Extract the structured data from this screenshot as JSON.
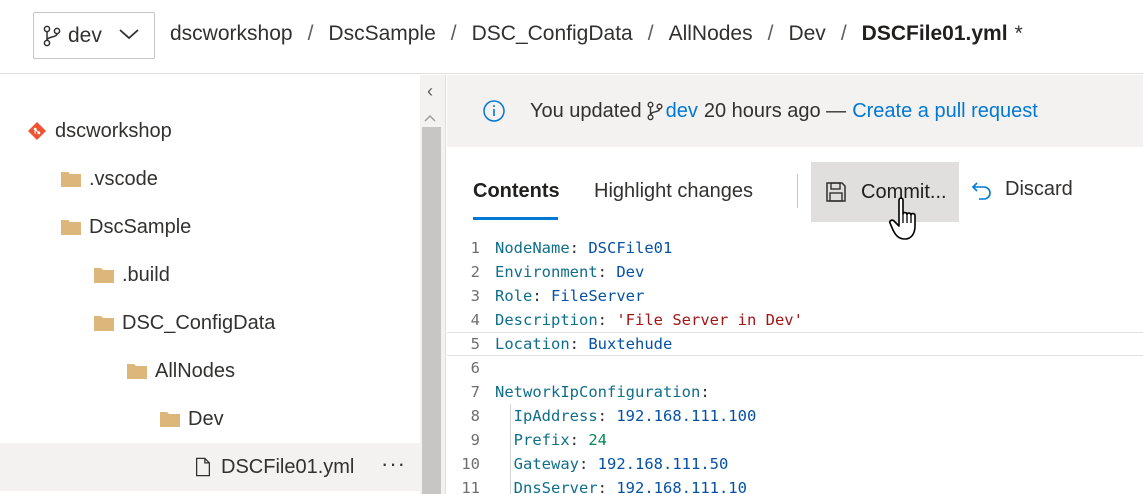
{
  "header": {
    "branch": "dev",
    "breadcrumb": [
      "dscworkshop",
      "DscSample",
      "DSC_ConfigData",
      "AllNodes",
      "Dev"
    ],
    "separator": "/",
    "current_file": "DSCFile01.yml",
    "dirty_marker": "*"
  },
  "tree": {
    "items": [
      {
        "label": "dscworkshop",
        "type": "repo"
      },
      {
        "label": ".vscode",
        "type": "folder"
      },
      {
        "label": "DscSample",
        "type": "folder"
      },
      {
        "label": ".build",
        "type": "folder"
      },
      {
        "label": "DSC_ConfigData",
        "type": "folder"
      },
      {
        "label": "AllNodes",
        "type": "folder"
      },
      {
        "label": "Dev",
        "type": "folder"
      },
      {
        "label": "DSCFile01.yml",
        "type": "file",
        "selected": true
      }
    ],
    "more_label": "···",
    "collapse_glyph": "‹"
  },
  "banner": {
    "prefix": "You updated",
    "branch": "dev",
    "suffix": "20 hours ago —",
    "link": "Create a pull request"
  },
  "toolbar": {
    "tabs": [
      "Contents",
      "Highlight changes"
    ],
    "active_tab": "Contents",
    "commit_label": "Commit...",
    "discard_label": "Discard"
  },
  "editor": {
    "lines": [
      {
        "n": "1",
        "key": "NodeName",
        "val": "DSCFile01",
        "kind": "val"
      },
      {
        "n": "2",
        "key": "Environment",
        "val": "Dev",
        "kind": "val"
      },
      {
        "n": "3",
        "key": "Role",
        "val": "FileServer",
        "kind": "val"
      },
      {
        "n": "4",
        "key": "Description",
        "val": "'File Server in Dev'",
        "kind": "str"
      },
      {
        "n": "5",
        "key": "Location",
        "val": "Buxtehude",
        "kind": "val"
      },
      {
        "n": "6",
        "key": "",
        "val": "",
        "kind": "blank"
      },
      {
        "n": "7",
        "key": "NetworkIpConfiguration",
        "val": "",
        "kind": "section"
      },
      {
        "n": "8",
        "key": "  IpAddress",
        "val": "192.168.111.100",
        "kind": "val"
      },
      {
        "n": "9",
        "key": "  Prefix",
        "val": "24",
        "kind": "num"
      },
      {
        "n": "10",
        "key": "  Gateway",
        "val": "192.168.111.50",
        "kind": "val"
      },
      {
        "n": "11",
        "key": "  DnsServer",
        "val": "192.168.111.10",
        "kind": "val"
      }
    ],
    "current_line": "5"
  },
  "colors": {
    "accent": "#0078d4",
    "key": "#0e6f8a",
    "value": "#0451a5",
    "string": "#a31515",
    "number": "#098658",
    "git_orange": "#f05133",
    "folder": "#dcb67a"
  }
}
